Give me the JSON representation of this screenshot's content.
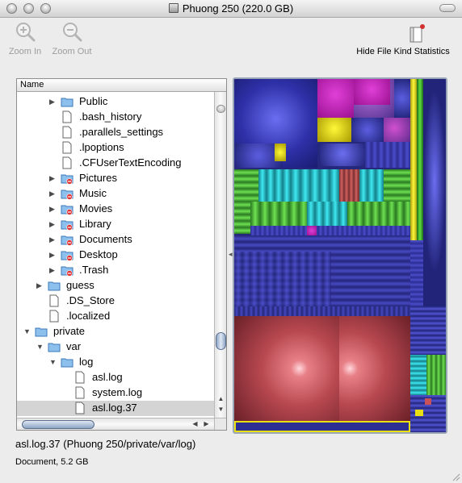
{
  "window": {
    "title": "Phuong 250 (220.0 GB)"
  },
  "toolbar": {
    "zoom_in": "Zoom In",
    "zoom_out": "Zoom Out",
    "hide_stats": "Hide File Kind Statistics"
  },
  "outline": {
    "column_name": "Name",
    "rows": [
      {
        "label": "Public"
      },
      {
        "label": ".bash_history"
      },
      {
        "label": ".parallels_settings"
      },
      {
        "label": ".lpoptions"
      },
      {
        "label": ".CFUserTextEncoding"
      },
      {
        "label": "Pictures"
      },
      {
        "label": "Music"
      },
      {
        "label": "Movies"
      },
      {
        "label": "Library"
      },
      {
        "label": "Documents"
      },
      {
        "label": "Desktop"
      },
      {
        "label": ".Trash"
      },
      {
        "label": "guess"
      },
      {
        "label": ".DS_Store"
      },
      {
        "label": ".localized"
      },
      {
        "label": "private"
      },
      {
        "label": "var"
      },
      {
        "label": "log"
      },
      {
        "label": "asl.log"
      },
      {
        "label": "system.log"
      },
      {
        "label": "asl.log.37"
      }
    ]
  },
  "status": {
    "path": "asl.log.37 (Phuong 250/private/var/log)",
    "kind": "Document, 5.2 GB"
  },
  "colors": {
    "blue": "#3a3cc4",
    "magenta": "#b01aa8",
    "yellow": "#e8e010",
    "green": "#3e9a2a",
    "cyan": "#18b8c0",
    "red": "#c85058",
    "selection": "#e8e010"
  }
}
